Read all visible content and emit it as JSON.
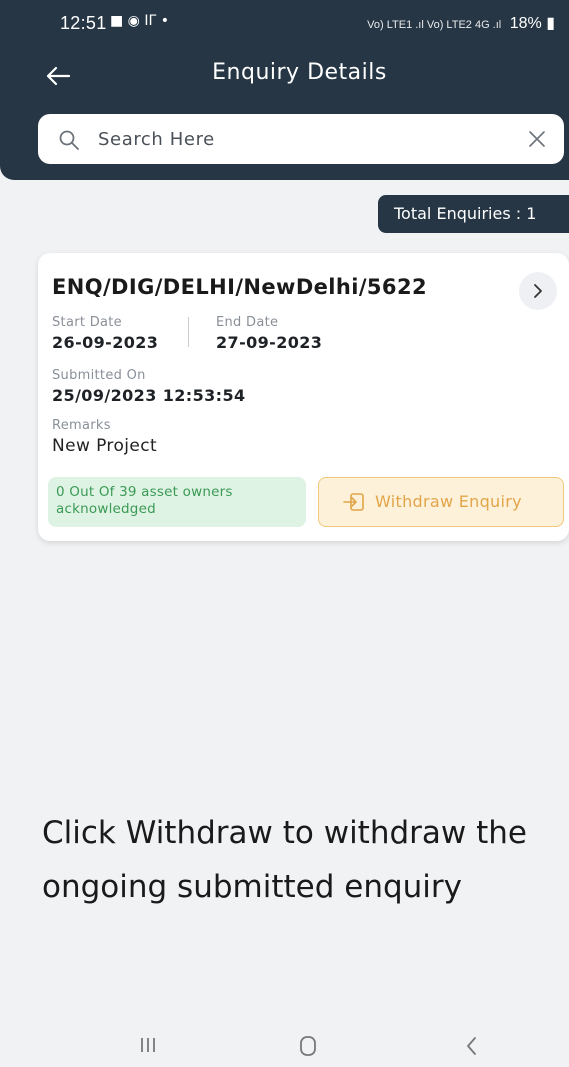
{
  "status_bar": {
    "time": "12:51",
    "left_icons": "■ ◉ ΙΓ •",
    "right_text": "18%",
    "signal_text": "Vo) LTE1 .ıl Vo) LTE2 4G .ıl"
  },
  "header": {
    "title": "Enquiry Details",
    "back_icon": "arrow-left-icon"
  },
  "search": {
    "placeholder": "Search Here",
    "value": ""
  },
  "total": {
    "label": "Total Enquiries : 1"
  },
  "enquiry": {
    "id": "ENQ/DIG/DELHI/NewDelhi/5622",
    "start_date_label": "Start Date",
    "start_date": "26-09-2023",
    "end_date_label": "End Date",
    "end_date": "27-09-2023",
    "submitted_label": "Submitted On",
    "submitted_on": "25/09/2023 12:53:54",
    "remarks_label": "Remarks",
    "remarks": "New Project",
    "ack_text": "0 Out Of 39 asset owners acknowledged",
    "withdraw_label": "Withdraw Enquiry"
  },
  "caption": "Click Withdraw to withdraw the ongoing submitted enquiry",
  "colors": {
    "header_bg": "#263645",
    "page_bg": "#f1f2f4",
    "ack_bg": "#dff3e4",
    "ack_text": "#3a9a55",
    "withdraw_bg": "#fdf1d9",
    "withdraw_text": "#e2a54a"
  }
}
